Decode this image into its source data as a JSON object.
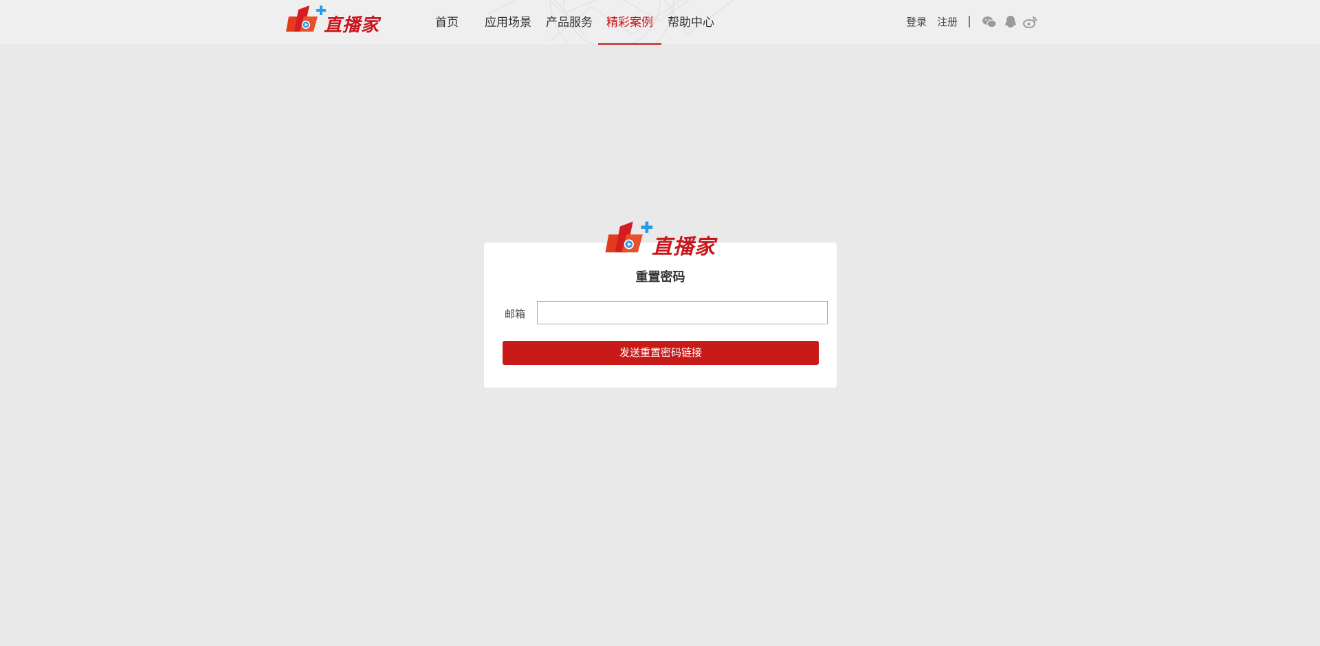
{
  "brand": {
    "name": "直播家",
    "colors": {
      "primary_red": "#c8161d",
      "accent_blue": "#2a9be8",
      "button_red": "#c91a1a"
    }
  },
  "nav": {
    "items": [
      {
        "label": "首页",
        "active": false
      },
      {
        "label": "应用场景",
        "active": false
      },
      {
        "label": "产品服务",
        "active": false
      },
      {
        "label": "精彩案例",
        "active": true
      },
      {
        "label": "帮助中心",
        "active": false
      }
    ]
  },
  "user_links": {
    "login": "登录",
    "register": "注册",
    "separator": "|",
    "social_icons": [
      "wechat-icon",
      "qq-icon",
      "weibo-icon"
    ]
  },
  "reset_form": {
    "title": "重置密码",
    "email_label": "邮箱",
    "email_value": "",
    "email_placeholder": "",
    "submit_label": "发送重置密码链接"
  }
}
